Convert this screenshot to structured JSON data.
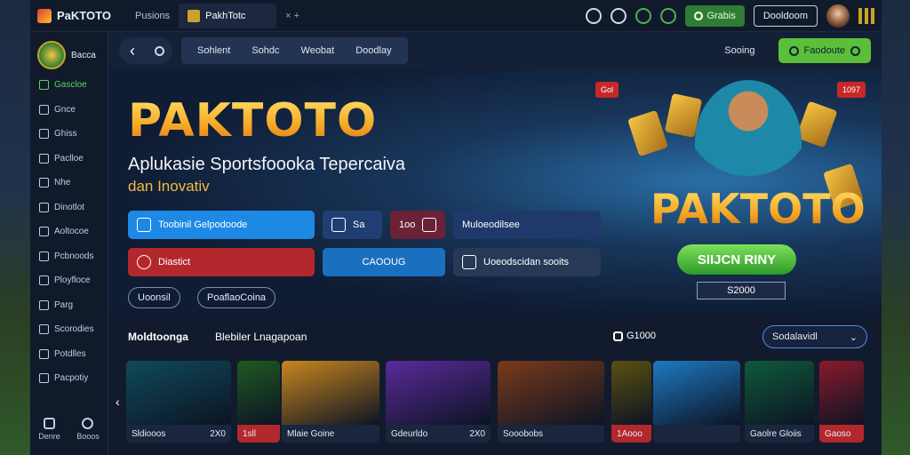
{
  "topbar": {
    "brand": "PaKTOTO",
    "tab_plain": "Pusions",
    "tab_active": "PakhTotc",
    "tab_controls": "× +",
    "btn_green": "Grabis",
    "btn_outline": "Dooldoom"
  },
  "sidebar": {
    "header": "Bacca",
    "items": [
      {
        "label": "Gascloe",
        "icon": "grid-icon",
        "active": true
      },
      {
        "label": "Gnce",
        "icon": "tools-icon",
        "active": false
      },
      {
        "label": "Ghiss",
        "icon": "chat-icon",
        "active": false
      },
      {
        "label": "Paclloe",
        "icon": "wallet-icon",
        "active": false
      },
      {
        "label": "Nhe",
        "icon": "tag-icon",
        "active": false
      },
      {
        "label": "Dinotlot",
        "icon": "list-icon",
        "active": false
      },
      {
        "label": "Aoltocoe",
        "icon": "calendar-icon",
        "active": false
      },
      {
        "label": "Pcbnoods",
        "icon": "gift-icon",
        "active": false
      },
      {
        "label": "Ployfloce",
        "icon": "star-icon",
        "active": false
      },
      {
        "label": "Parg",
        "icon": "flag-icon",
        "active": false
      },
      {
        "label": "Scorodies",
        "icon": "chart-icon",
        "active": false
      },
      {
        "label": "Potdlles",
        "icon": "trophy-icon",
        "active": false
      },
      {
        "label": "Pacpotiy",
        "icon": "shield-icon",
        "active": false
      }
    ],
    "bottom": [
      {
        "label": "Denre",
        "icon": "home-icon"
      },
      {
        "label": "Booos",
        "icon": "search-icon"
      }
    ]
  },
  "navbar": {
    "tabs": [
      "Sohlent",
      "Sohdc",
      "Weobat",
      "Doodlay"
    ],
    "link": "Sooing",
    "cta": "Faodoute"
  },
  "hero": {
    "title": "PAKTOTO",
    "subtitle": "Aplukasie Sportsfoooka Tepercaiva",
    "subtitle2": "dan Inovativ",
    "btn1": "Toobinil Gelpodoode",
    "btn2": "Sa",
    "btn3": "1oo",
    "btn4": "Muloeodilsee",
    "btn5": "Diastict",
    "btn6": "CAOOUG",
    "btn7": "Uoeodscidan sooits",
    "pill1": "Uoonsil",
    "pill2": "PoaflaoCoina",
    "art_logo": "PAKTOTO",
    "art_cta": "SIIJCN RINY",
    "art_badge": "S2000",
    "tag_left": "Gol",
    "tag_right": "1097"
  },
  "games": {
    "heading": "Moldtoonga",
    "heading_sub": "Blebiler Lnagapoan",
    "mid_label": "G1000",
    "select_label": "Sodalavidl",
    "cards": [
      {
        "label": "Sldiooos",
        "meta": "2X0",
        "color": "#0f4a5a",
        "red": false
      },
      {
        "label": "1sll",
        "meta": "",
        "color": "#1f5a20",
        "red": true
      },
      {
        "label": "Mlaie Goine",
        "meta": "",
        "color": "#c8861e",
        "red": false
      },
      {
        "label": "Gdeurldo",
        "meta": "2X0",
        "color": "#5a2a9a",
        "red": false
      },
      {
        "label": "Sooobobs",
        "meta": "",
        "color": "#7a3a1a",
        "red": false
      },
      {
        "label": "1Aooo",
        "meta": "",
        "color": "#5a5010",
        "red": true
      },
      {
        "label": "",
        "meta": "",
        "color": "#1e7ac2",
        "red": false
      },
      {
        "label": "Gaolre Gloiis",
        "meta": "",
        "color": "#0f5a3a",
        "red": false
      },
      {
        "label": "Gaoso",
        "meta": "",
        "color": "#8a1a2a",
        "red": true
      }
    ]
  }
}
